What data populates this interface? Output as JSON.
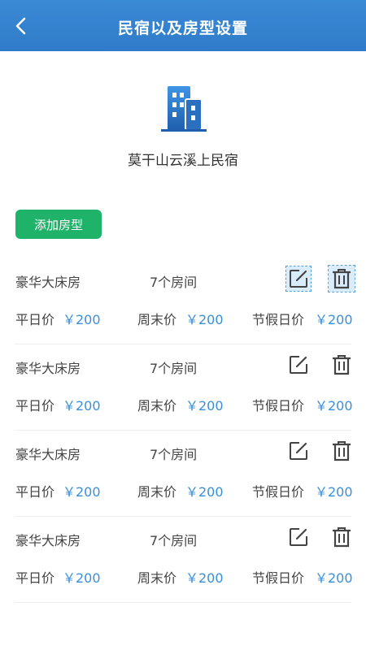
{
  "header": {
    "title": "民宿以及房型设置"
  },
  "hotel": {
    "name": "莫干山云溪上民宿"
  },
  "add_button": "添加房型",
  "labels": {
    "weekday": "平日价",
    "weekend": "周末价",
    "holiday": "节假日价"
  },
  "rooms": [
    {
      "name": "豪华大床房",
      "count": "7个房间",
      "weekday": "￥200",
      "weekend": "￥200",
      "holiday": "￥200"
    },
    {
      "name": "豪华大床房",
      "count": "7个房间",
      "weekday": "￥200",
      "weekend": "￥200",
      "holiday": "￥200"
    },
    {
      "name": "豪华大床房",
      "count": "7个房间",
      "weekday": "￥200",
      "weekend": "￥200",
      "holiday": "￥200"
    },
    {
      "name": "豪华大床房",
      "count": "7个房间",
      "weekday": "￥200",
      "weekend": "￥200",
      "holiday": "￥200"
    }
  ],
  "colors": {
    "header": "#2f7bc9",
    "add_button": "#1fb36a",
    "price": "#3a8fd9"
  },
  "icons": {
    "back": "chevron-left-icon",
    "hotel": "building-icon",
    "edit": "edit-icon",
    "delete": "trash-icon"
  }
}
